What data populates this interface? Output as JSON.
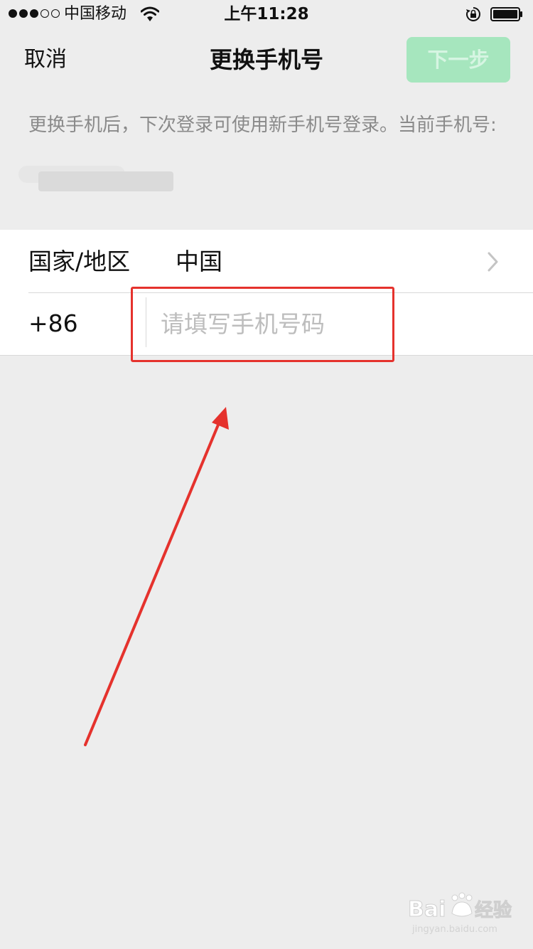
{
  "status_bar": {
    "carrier": "中国移动",
    "time": "上午11:28",
    "signal_dots_filled": 3,
    "signal_dots_total": 5,
    "icons": [
      "signal-icon",
      "wifi-icon",
      "orientation-lock-icon",
      "battery-icon"
    ]
  },
  "nav": {
    "cancel_label": "取消",
    "title": "更换手机号",
    "next_label": "下一步"
  },
  "description": "更换手机后，下次登录可使用新手机号登录。当前手机号:",
  "form": {
    "country_label": "国家/地区",
    "country_value": "中国",
    "dial_code": "+86",
    "phone_value": "",
    "phone_placeholder": "请填写手机号码"
  },
  "colors": {
    "page_background": "#EDEDED",
    "button_disabled": "#A6E6BE",
    "annotation_red": "#E5322D"
  },
  "watermark": {
    "logo_text": "Bai经验",
    "url": "jingyan.baidu.com"
  }
}
